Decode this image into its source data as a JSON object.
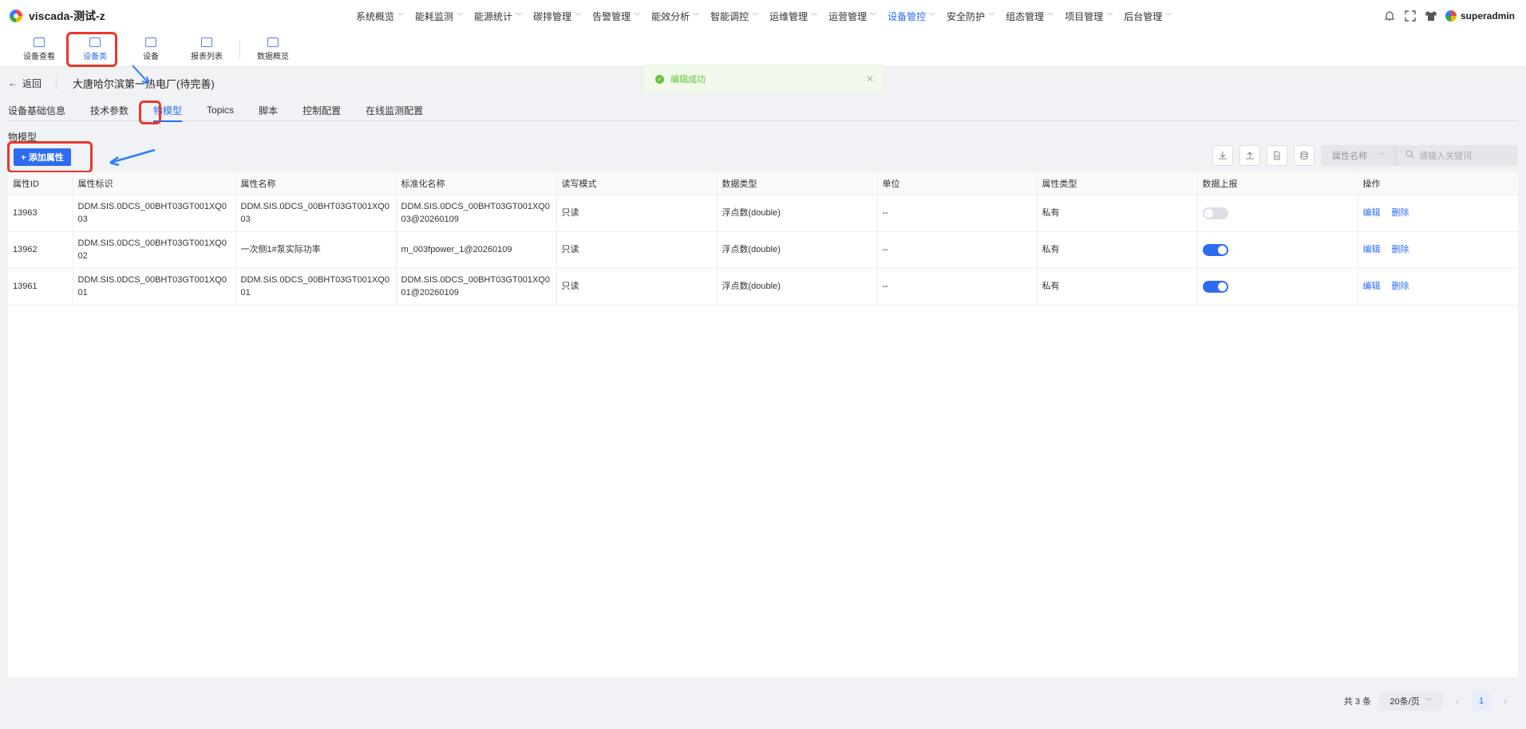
{
  "app": {
    "title": "viscada-测试-z"
  },
  "nav": {
    "items": [
      {
        "label": "系统概览"
      },
      {
        "label": "能耗监测"
      },
      {
        "label": "能源统计"
      },
      {
        "label": "碳排管理"
      },
      {
        "label": "告警管理"
      },
      {
        "label": "能效分析"
      },
      {
        "label": "智能调控"
      },
      {
        "label": "运维管理"
      },
      {
        "label": "运营管理"
      },
      {
        "label": "设备管控"
      },
      {
        "label": "安全防护"
      },
      {
        "label": "组态管理"
      },
      {
        "label": "项目管理"
      },
      {
        "label": "后台管理"
      }
    ],
    "active_index": 9
  },
  "user": {
    "name": "superadmin"
  },
  "toolbar": {
    "items": [
      {
        "label": "设备查看"
      },
      {
        "label": "设备类"
      },
      {
        "label": "设备"
      },
      {
        "label": "报表列表"
      },
      {
        "label": "数据概览"
      }
    ],
    "active_index": 1
  },
  "header": {
    "back_label": "返回",
    "device_title": "大唐哈尔滨第一热电厂(待完善)"
  },
  "toast": {
    "text": "编辑成功"
  },
  "tabs": {
    "items": [
      {
        "label": "设备基础信息"
      },
      {
        "label": "技术参数"
      },
      {
        "label": "物模型"
      },
      {
        "label": "Topics"
      },
      {
        "label": "脚本"
      },
      {
        "label": "控制配置"
      },
      {
        "label": "在线监测配置"
      }
    ],
    "active_index": 2
  },
  "section": {
    "label": "物模型",
    "add_button": "+ 添加属性"
  },
  "filter": {
    "select_value": "属性名称",
    "placeholder": "请输入关键词"
  },
  "table": {
    "columns": [
      "属性ID",
      "属性标识",
      "属性名称",
      "标准化名称",
      "读写模式",
      "数据类型",
      "单位",
      "属性类型",
      "数据上报",
      "操作"
    ],
    "rows": [
      {
        "id": "13963",
        "identifier": "DDM.SIS.0DCS_00BHT03GT001XQ003",
        "name": "DDM.SIS.0DCS_00BHT03GT001XQ003",
        "std_name": "DDM.SIS.0DCS_00BHT03GT001XQ003@20260109",
        "rw": "只读",
        "dtype": "浮点数(double)",
        "unit": "--",
        "ptype": "私有",
        "report": false,
        "edit": "编辑",
        "del": "删除"
      },
      {
        "id": "13962",
        "identifier": "DDM.SIS.0DCS_00BHT03GT001XQ002",
        "name": "一次侧1#泵实际功率",
        "std_name": "m_003fpower_1@20260109",
        "rw": "只读",
        "dtype": "浮点数(double)",
        "unit": "--",
        "ptype": "私有",
        "report": true,
        "edit": "编辑",
        "del": "删除"
      },
      {
        "id": "13961",
        "identifier": "DDM.SIS.0DCS_00BHT03GT001XQ001",
        "name": "DDM.SIS.0DCS_00BHT03GT001XQ001",
        "std_name": "DDM.SIS.0DCS_00BHT03GT001XQ001@20260109",
        "rw": "只读",
        "dtype": "浮点数(double)",
        "unit": "--",
        "ptype": "私有",
        "report": true,
        "edit": "编辑",
        "del": "删除"
      }
    ]
  },
  "pagination": {
    "total_label": "共 3 条",
    "page_size": "20条/页",
    "current_page": "1"
  },
  "colors": {
    "primary": "#2d6cf0",
    "annotation": "#e8382a",
    "success": "#67c23a"
  }
}
